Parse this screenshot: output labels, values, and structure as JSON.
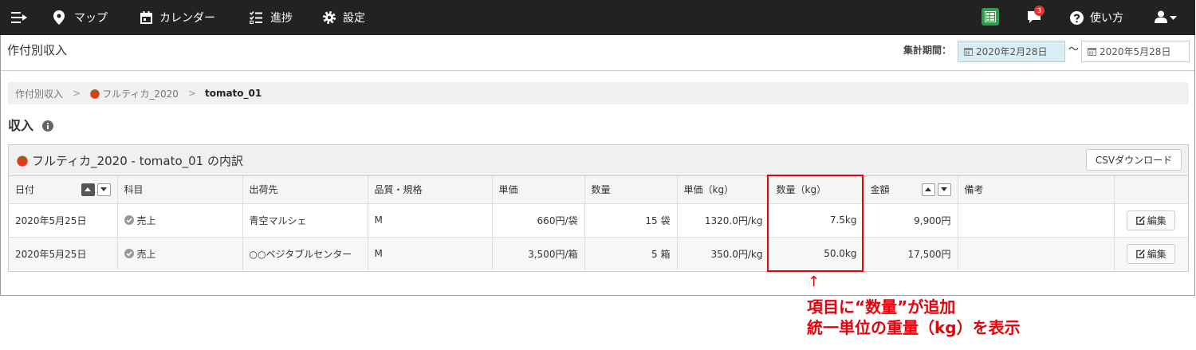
{
  "nav": {
    "menu_icon": "menu-toggle-icon",
    "items": [
      {
        "icon": "map-marker-icon",
        "label": "マップ"
      },
      {
        "icon": "calendar-icon",
        "label": "カレンダー"
      },
      {
        "icon": "tasks-icon",
        "label": "進捗"
      },
      {
        "icon": "gear-icon",
        "label": "設定"
      }
    ],
    "spreadsheet_icon": "spreadsheet-icon",
    "messages_icon": "comment-icon",
    "messages_badge": "3",
    "help_icon": "question-circle-icon",
    "help_label": "使い方",
    "user_icon": "user-icon"
  },
  "header": {
    "title": "作付別収入",
    "period_label": "集計期間：",
    "date_from": "2020年2月28日",
    "date_separator": "〜",
    "date_to": "2020年5月28日"
  },
  "breadcrumb": {
    "separator": ">",
    "items": [
      {
        "label": "作付別収入"
      },
      {
        "label": "フルティカ_2020",
        "icon": "tomato-icon"
      },
      {
        "label": "tomato_01",
        "active": true
      }
    ]
  },
  "section": {
    "title": "収入",
    "icon": "info-icon"
  },
  "panel": {
    "title_icon": "tomato-icon",
    "title": "フルティカ_2020 - tomato_01 の内訳",
    "csv_button": "CSVダウンロード"
  },
  "table": {
    "columns": [
      {
        "label": "日付"
      },
      {
        "label": "科目"
      },
      {
        "label": "出荷先"
      },
      {
        "label": "品質・規格"
      },
      {
        "label": "単価"
      },
      {
        "label": "数量"
      },
      {
        "label": "単価（kg）"
      },
      {
        "label": "数量（kg）"
      },
      {
        "label": "金額"
      },
      {
        "label": "備考"
      }
    ],
    "sort": {
      "date": "asc",
      "amount": "none"
    },
    "edit_label": "編集",
    "rows": [
      {
        "date": "2020年5月25日",
        "category": "売上",
        "destination": "青空マルシェ",
        "grade": "M",
        "unit_price": "660円/袋",
        "quantity": "15 袋",
        "unit_price_kg": "1320.0円/kg",
        "quantity_kg": "7.5kg",
        "amount": "9,900円",
        "note": ""
      },
      {
        "date": "2020年5月25日",
        "category": "売上",
        "destination": "○○ベジタブルセンター",
        "grade": "M",
        "unit_price": "3,500円/箱",
        "quantity": "5 箱",
        "unit_price_kg": "350.0円/kg",
        "quantity_kg": "50.0kg",
        "amount": "17,500円",
        "note": ""
      }
    ]
  },
  "annotation": {
    "arrow": "↑",
    "line1": "項目に“数量”が追加",
    "line2": "統一単位の重量（kg）を表示"
  },
  "colors": {
    "nav_bg": "#222222",
    "date_highlight": "#d9edf7",
    "spreadsheet_green": "#2e9d4e",
    "badge_red": "#e3342f",
    "annotation_red": "#e8000b",
    "tomato_red": "#e23b1c"
  }
}
